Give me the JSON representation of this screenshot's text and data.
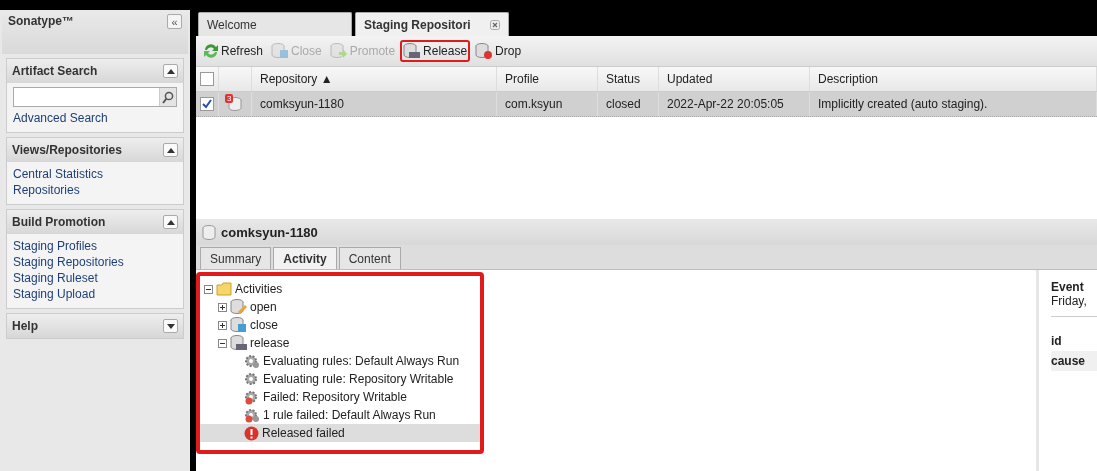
{
  "sidebar": {
    "title": "Sonatype™",
    "collapse_label": "«",
    "panels": [
      {
        "title": "Artifact Search",
        "expanded": true,
        "kind": "search",
        "links": [
          "Advanced Search"
        ]
      },
      {
        "title": "Views/Repositories",
        "expanded": true,
        "links": [
          "Central Statistics",
          "Repositories"
        ]
      },
      {
        "title": "Build Promotion",
        "expanded": true,
        "links": [
          "Staging Profiles",
          "Staging Repositories",
          "Staging Ruleset",
          "Staging Upload"
        ]
      },
      {
        "title": "Help",
        "expanded": false
      }
    ]
  },
  "tabs": [
    {
      "label": "Welcome",
      "selected": false,
      "closable": false
    },
    {
      "label": "Staging Repositori",
      "selected": true,
      "closable": true
    }
  ],
  "toolbar": [
    {
      "label": "Refresh",
      "kind": "refresh",
      "disabled": false,
      "highlighted": false
    },
    {
      "label": "Close",
      "kind": "close",
      "disabled": true,
      "highlighted": false
    },
    {
      "label": "Promote",
      "kind": "promote",
      "disabled": true,
      "highlighted": false
    },
    {
      "label": "Release",
      "kind": "release",
      "disabled": false,
      "highlighted": true
    },
    {
      "label": "Drop",
      "kind": "drop",
      "disabled": false,
      "highlighted": false
    }
  ],
  "table": {
    "all_checked": false,
    "columns": [
      "Repository ▲",
      "Profile",
      "Status",
      "Updated",
      "Description"
    ],
    "rows": [
      {
        "checked": true,
        "selected": true,
        "badge": "3",
        "cells": [
          "comksyun-1180",
          "com.ksyun",
          "closed",
          "2022-Apr-22 20:05:05",
          "Implicitly created (auto staging)."
        ]
      }
    ]
  },
  "detail": {
    "title": "comksyun-1180",
    "tabs": [
      {
        "label": "Summary",
        "selected": false
      },
      {
        "label": "Activity",
        "selected": true
      },
      {
        "label": "Content",
        "selected": false
      }
    ],
    "tree_highlighted": true,
    "tree": [
      {
        "label": "Activities",
        "kind": "folder",
        "expanded": true,
        "selected": false,
        "children": [
          {
            "label": "open",
            "kind": "edit",
            "expanded": false,
            "selected": false
          },
          {
            "label": "close",
            "kind": "save",
            "expanded": false,
            "selected": false
          },
          {
            "label": "release",
            "kind": "release",
            "expanded": true,
            "selected": false,
            "children": [
              {
                "label": "Evaluating rules: Default Always Run",
                "kind": "gears",
                "selected": false
              },
              {
                "label": "Evaluating rule: Repository Writable",
                "kind": "gear",
                "selected": false
              },
              {
                "label": "Failed: Repository Writable",
                "kind": "gearfail",
                "selected": false
              },
              {
                "label": "1 rule failed: Default Always Run",
                "kind": "gearsfail",
                "selected": false
              },
              {
                "label": "Released failed",
                "kind": "error",
                "selected": true
              }
            ]
          }
        ]
      }
    ],
    "event": {
      "title": "Event",
      "subtitle": "Friday,",
      "fields": [
        "id",
        "cause"
      ]
    }
  }
}
